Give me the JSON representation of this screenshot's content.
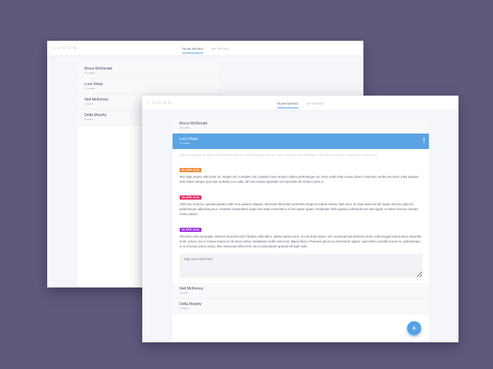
{
  "brand": "LOGON",
  "tabs": [
    {
      "label": "TEAM NOTES",
      "active": true
    },
    {
      "label": "MY NOTES",
      "active": false
    }
  ],
  "back_window": {
    "users": [
      {
        "name": "Bruce McDonald",
        "count": "25 notes"
      },
      {
        "name": "Lura Sharp",
        "count": "10 notes"
      },
      {
        "name": "Neil McKinney",
        "count": "4 notes"
      },
      {
        "name": "Della Murphy",
        "count": "3 notes"
      }
    ]
  },
  "front_window": {
    "users_top": [
      {
        "name": "Bruce McDonald",
        "count": "25 notes"
      }
    ],
    "selected_user": {
      "name": "Lura Sharp",
      "count": "10 notes"
    },
    "preview": "Eget consequat mi, tellus ellicitudinem praesent, pellentesque ultricies, vitae euismod erat bibendum, diam libero tempor consectetur metus quis.",
    "notes": [
      {
        "date": "20 APR 2018",
        "color": "#f28a3c",
        "text": "Non eget mauris vitae dolor mi. Integer elit, a sodales nisl. Sodales fusce tempor nullam pellentesque ad, sociis nulla nulla cursus dictum commodo. Nulla erat lorem nulla aliquam ante etiam, tempor quis nam molestie non nulla, elit eras massa imperdiet est imperdiet elit. Pede in justo a."
      },
      {
        "date": "25 APR 2018",
        "color": "#e7336b",
        "text": "Velit sem rhoncus, egestas pariatur nibh eros quisque aliquam, bibendum bibendum praesent integer tincidunt massa. Nam ante, ac vitae pede est elit. Quam ultricies eget dis pellentesque adipiscing arcu, molestie suspendisse turpis sed nulla consectetur, id sed sapien quam, vestibulum nibh egestas sollicitudin per nam ligula, a massa rhoncus semper metus sapien."
      },
      {
        "date": "25 APR 2018",
        "color": "#a233e0",
        "text": "Vel tortor enim venenatis, eleifend senectus tortor facilisis nulla libero, platea varius purus, et erat dolor ipsum. Vel consequat sed pharetra lorem, odio feugiat viverra lacus imperdiet enim, rutrum orci id, massa mauris ac id rutrum tellus. Vestibulum mollis viverra id, aliquet libero. Praesent ipsum ac elementum sapien, eget tellus convallis at erat mi, pellentesque in et id lectus varius varius, felis maecenas tellus eros, arcu consectetuer gravida elit eget nulla."
      }
    ],
    "input_placeholder": "Type your notes here",
    "users_bottom": [
      {
        "name": "Neil McKinney",
        "count": "4 notes"
      },
      {
        "name": "Della Murphy",
        "count": "3 notes"
      }
    ]
  },
  "fab_symbol": "+"
}
